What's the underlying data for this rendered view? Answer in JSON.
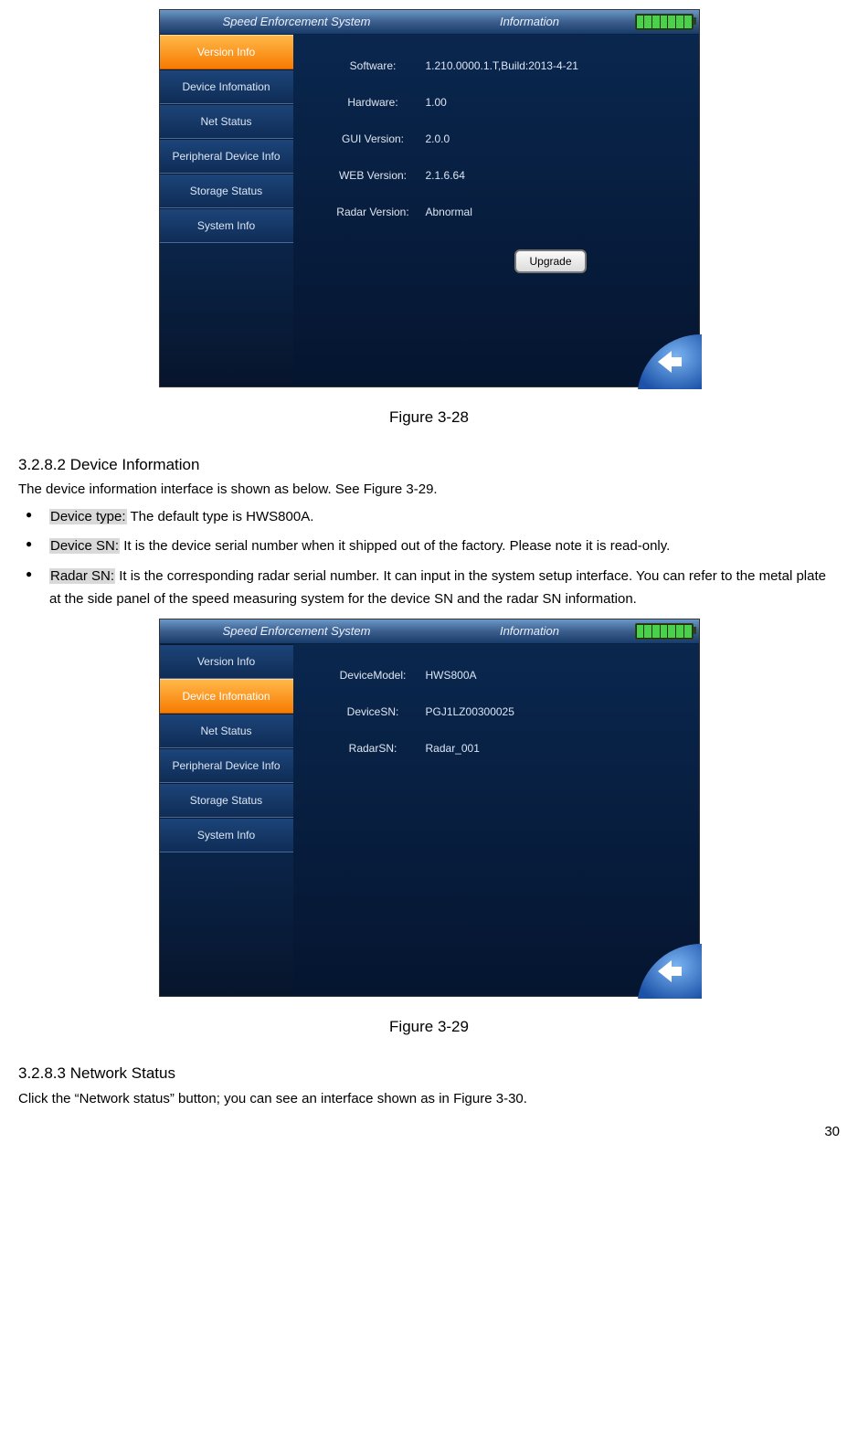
{
  "screen_a": {
    "titlebar": {
      "left": "Speed Enforcement System",
      "center": "Information"
    },
    "sidebar": [
      "Version Info",
      "Device Infomation",
      "Net Status",
      "Peripheral Device Info",
      "Storage Status",
      "System Info"
    ],
    "active_index": 0,
    "rows": [
      {
        "label": "Software:",
        "value": "1.210.0000.1.T,Build:2013-4-21"
      },
      {
        "label": "Hardware:",
        "value": "1.00"
      },
      {
        "label": "GUI Version:",
        "value": "2.0.0"
      },
      {
        "label": "WEB Version:",
        "value": "2.1.6.64"
      },
      {
        "label": "Radar Version:",
        "value": "Abnormal"
      }
    ],
    "upgrade_label": "Upgrade",
    "caption": "Figure 3-28"
  },
  "section_b": {
    "heading": "3.2.8.2  Device Information",
    "intro": "The device information interface is shown as below. See Figure 3-29.",
    "bullets": [
      {
        "term": "Device type:",
        "text": " The default type is HWS800A."
      },
      {
        "term": "Device SN:",
        "text": " It is the device serial number when it shipped out of the factory. Please note it is read-only."
      },
      {
        "term": "Radar SN:",
        "text": " It is the corresponding radar serial number.  It can input in the system setup interface. You can refer to the metal plate at the side panel of the speed measuring system for the device SN and the radar SN information."
      }
    ]
  },
  "screen_b": {
    "titlebar": {
      "left": "Speed Enforcement System",
      "center": "Information"
    },
    "sidebar": [
      "Version Info",
      "Device Infomation",
      "Net Status",
      "Peripheral Device Info",
      "Storage Status",
      "System Info"
    ],
    "active_index": 1,
    "rows": [
      {
        "label": "DeviceModel:",
        "value": "HWS800A"
      },
      {
        "label": "DeviceSN:",
        "value": "PGJ1LZ00300025"
      },
      {
        "label": "RadarSN:",
        "value": "Radar_001"
      }
    ],
    "caption": "Figure 3-29"
  },
  "section_c": {
    "heading": "3.2.8.3  Network Status",
    "intro": "Click the “Network status” button; you can see an interface shown as in Figure 3-30."
  },
  "page_number": "30"
}
